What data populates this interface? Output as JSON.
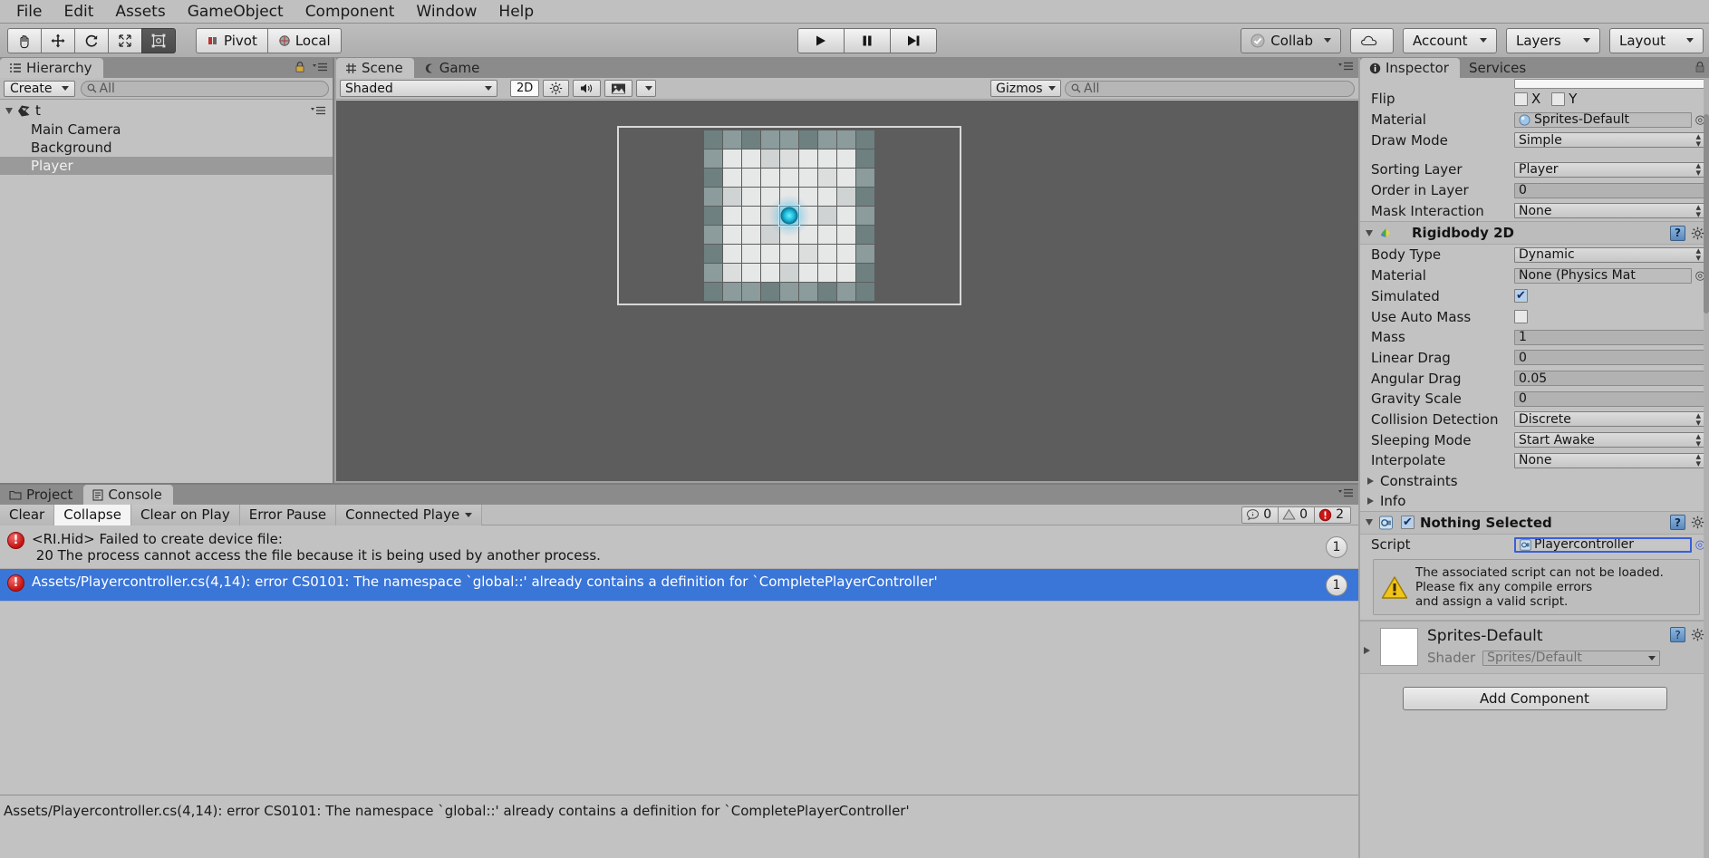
{
  "menu": {
    "items": [
      "File",
      "Edit",
      "Assets",
      "GameObject",
      "Component",
      "Window",
      "Help"
    ]
  },
  "toolbar": {
    "tools": [
      {
        "name": "hand-tool",
        "label": ""
      },
      {
        "name": "move-tool",
        "label": ""
      },
      {
        "name": "rotate-tool",
        "label": ""
      },
      {
        "name": "scale-tool",
        "label": ""
      },
      {
        "name": "rect-tool",
        "label": ""
      }
    ],
    "pivot_label": "Pivot",
    "local_label": "Local",
    "play_label": "Play",
    "pause_label": "Pause",
    "step_label": "Step",
    "collab_label": "Collab",
    "cloud_label": "",
    "account_label": "Account",
    "layers_label": "Layers",
    "layout_label": "Layout"
  },
  "hierarchy": {
    "tab_label": "Hierarchy",
    "create_label": "Create",
    "search_placeholder": "All",
    "scene_name": "t",
    "objects": [
      {
        "label": "Main Camera",
        "selected": false
      },
      {
        "label": "Background",
        "selected": false
      },
      {
        "label": "Player",
        "selected": true
      }
    ]
  },
  "scene": {
    "tabs": [
      {
        "label": "Scene",
        "active": true
      },
      {
        "label": "Game",
        "active": false
      }
    ],
    "shading_mode": "Shaded",
    "mode_2d": "2D",
    "gizmos_label": "Gizmos",
    "search_placeholder": "All"
  },
  "console": {
    "tabs": [
      {
        "label": "Project",
        "active": false
      },
      {
        "label": "Console",
        "active": true
      }
    ],
    "buttons": [
      {
        "label": "Clear",
        "active": false
      },
      {
        "label": "Collapse",
        "active": true
      },
      {
        "label": "Clear on Play",
        "active": false
      },
      {
        "label": "Error Pause",
        "active": false
      },
      {
        "label": "Connected Playe",
        "active": false
      }
    ],
    "counts": {
      "info": "0",
      "warning": "0",
      "error": "2"
    },
    "entries": [
      {
        "type": "error",
        "message": "<RI.Hid> Failed to create device file:\n 20 The process cannot access the file because it is being used by another process.",
        "count": "1",
        "selected": false
      },
      {
        "type": "error",
        "message": "Assets/Playercontroller.cs(4,14): error CS0101: The namespace `global::' already contains a definition for `CompletePlayerController'",
        "count": "1",
        "selected": true
      }
    ],
    "detail_text": "Assets/Playercontroller.cs(4,14): error CS0101: The namespace `global::' already contains a definition for `CompletePlayerController'"
  },
  "inspector": {
    "tabs": [
      {
        "label": "Inspector",
        "active": true
      },
      {
        "label": "Services",
        "active": false
      }
    ],
    "sprite_renderer": {
      "rows": [
        {
          "label": "Flip",
          "type": "flip",
          "x_label": "X",
          "y_label": "Y",
          "x_checked": false,
          "y_checked": false
        },
        {
          "label": "Material",
          "type": "object",
          "value": "Sprites-Default"
        },
        {
          "label": "Draw Mode",
          "type": "enum",
          "value": "Simple"
        },
        {
          "label": "",
          "type": "spacer",
          "value": ""
        },
        {
          "label": "Sorting Layer",
          "type": "enum",
          "value": "Player"
        },
        {
          "label": "Order in Layer",
          "type": "text",
          "value": "0"
        },
        {
          "label": "Mask Interaction",
          "type": "enum",
          "value": "None"
        }
      ]
    },
    "rigidbody2d": {
      "title": "Rigidbody 2D",
      "rows": [
        {
          "label": "Body Type",
          "type": "enum",
          "value": "Dynamic"
        },
        {
          "label": "Material",
          "type": "object",
          "value": "None (Physics Mat"
        },
        {
          "label": "Simulated",
          "type": "checkbox",
          "checked": true
        },
        {
          "label": "Use Auto Mass",
          "type": "checkbox",
          "checked": false
        },
        {
          "label": "Mass",
          "type": "text",
          "value": "1"
        },
        {
          "label": "Linear Drag",
          "type": "text",
          "value": "0"
        },
        {
          "label": "Angular Drag",
          "type": "text",
          "value": "0.05"
        },
        {
          "label": "Gravity Scale",
          "type": "text",
          "value": "0"
        },
        {
          "label": "Collision Detection",
          "type": "enum",
          "value": "Discrete"
        },
        {
          "label": "Sleeping Mode",
          "type": "enum",
          "value": "Start Awake"
        },
        {
          "label": "Interpolate",
          "type": "enum",
          "value": "None"
        }
      ],
      "foldouts": [
        "Constraints",
        "Info"
      ]
    },
    "script_component": {
      "title": "Nothing Selected",
      "enabled": true,
      "script_label": "Script",
      "script_value": "Playercontroller",
      "warning_text": "The associated script can not be loaded.\nPlease fix any compile errors\nand assign a valid script."
    },
    "material_block": {
      "title": "Sprites-Default",
      "shader_label": "Shader",
      "shader_value": "Sprites/Default"
    },
    "add_component_label": "Add Component"
  }
}
